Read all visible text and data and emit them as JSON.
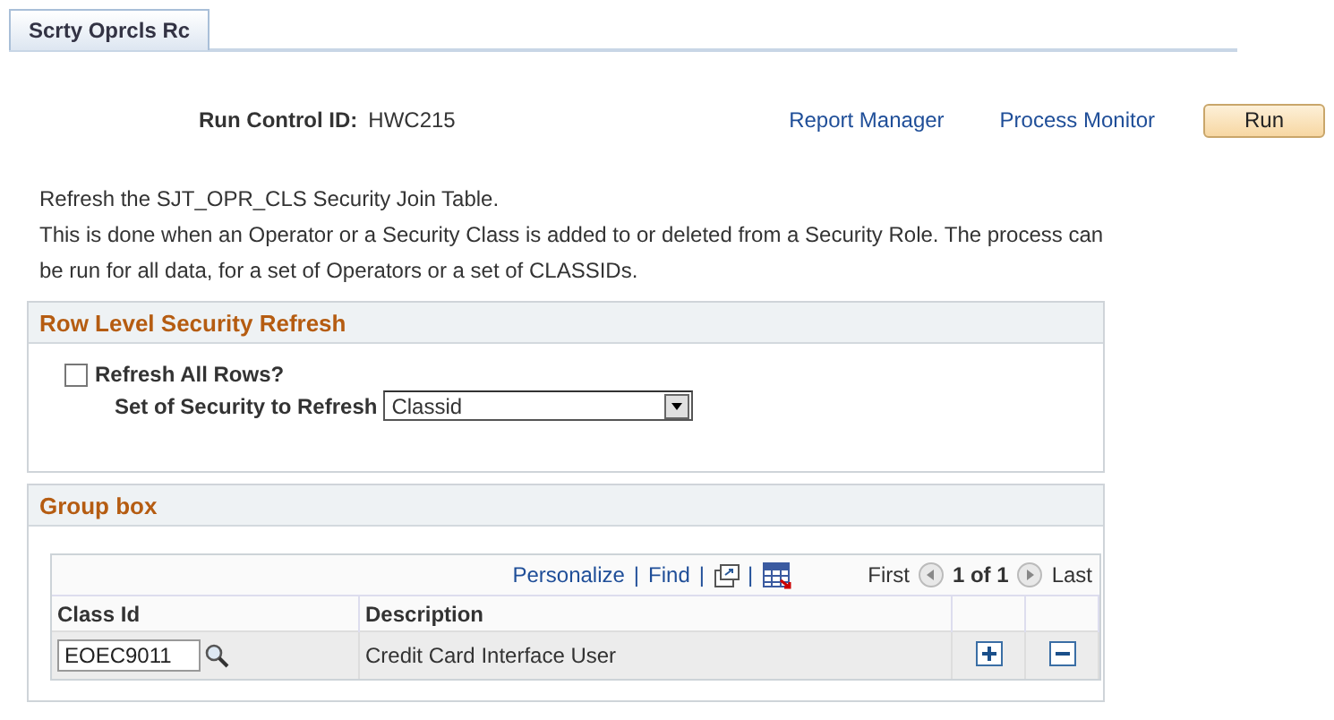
{
  "tabs": [
    {
      "label": "Scrty Oprcls Rc",
      "selected": true
    }
  ],
  "run_control": {
    "label": "Run Control ID:",
    "value": "HWC215"
  },
  "links": [
    "Report Manager",
    "Process Monitor"
  ],
  "run_button": "Run",
  "description": [
    "Refresh the SJT_OPR_CLS Security Join Table.",
    "This is done when an Operator or a Security Class is added to or deleted from a Security Role. The process can be run for all data, for a set of Operators or a set of CLASSIDs."
  ],
  "row_level_section": {
    "title": "Row Level Security Refresh",
    "refresh_all": {
      "label": "Refresh All Rows?",
      "checked": false
    },
    "set_field": {
      "label": "Set of Security to Refresh",
      "value": "Classid"
    }
  },
  "group_box": {
    "title": "Group box",
    "grid": {
      "toolbar": {
        "personalize": "Personalize",
        "separator_1": "|",
        "find": "Find",
        "separator_2": "|",
        "separator_3": "|",
        "first": "First",
        "count": "1 of 1",
        "last": "Last"
      },
      "columns": [
        "Class Id",
        "Description"
      ],
      "rows": [
        {
          "class_id": "EOEC9011",
          "description": "Credit Card Interface User"
        }
      ]
    }
  }
}
